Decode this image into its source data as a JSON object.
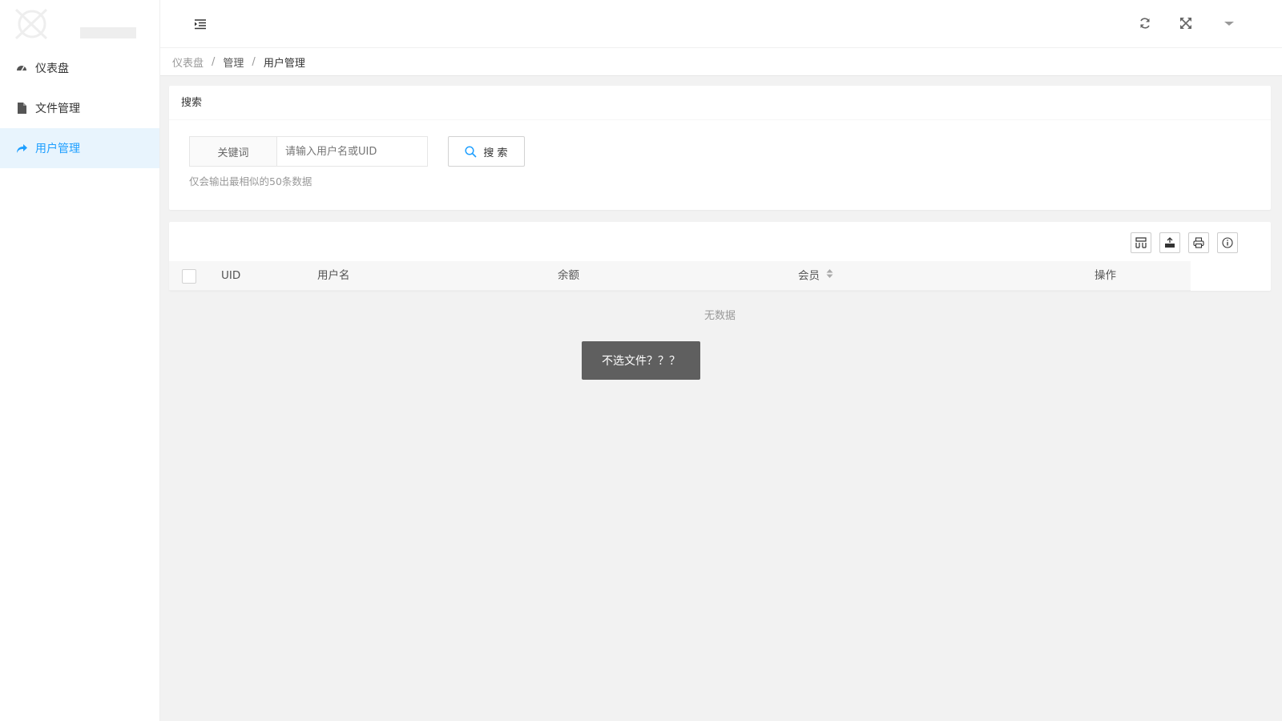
{
  "sidebar": {
    "items": [
      {
        "label": "仪表盘",
        "icon": "dashboard-icon"
      },
      {
        "label": "文件管理",
        "icon": "file-icon"
      },
      {
        "label": "用户管理",
        "icon": "share-icon",
        "active": true
      }
    ]
  },
  "header": {
    "icons": [
      "menu-fold-icon",
      "refresh-icon",
      "fullscreen-icon",
      "dropdown-icon"
    ]
  },
  "breadcrumb": [
    "仪表盘",
    "管理",
    "用户管理"
  ],
  "search_card": {
    "title": "搜索",
    "keyword_label": "关键词",
    "input_placeholder": "请输入用户名或UID",
    "input_value": "",
    "button_label": "搜 索",
    "hint": "仅会输出最相似的50条数据"
  },
  "table": {
    "toolbar": [
      "columns-icon",
      "export-icon",
      "print-icon",
      "info-icon"
    ],
    "columns": [
      "UID",
      "用户名",
      "余额",
      "会员",
      "操作"
    ],
    "rows": [],
    "empty_text": "无数据"
  },
  "toast": {
    "message": "不选文件？？？"
  },
  "colors": {
    "accent": "#1e9fff",
    "active_bg": "#e8f4fd",
    "toast_bg": "#5f5f5f"
  }
}
